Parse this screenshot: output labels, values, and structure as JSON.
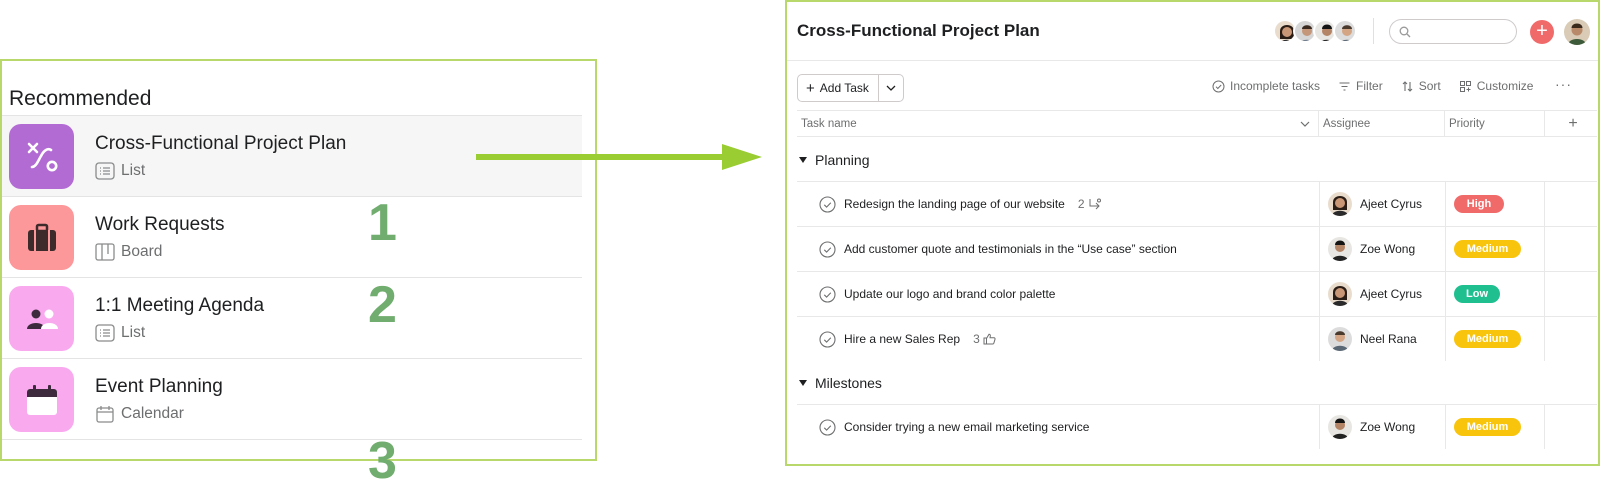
{
  "recommended": {
    "heading": "Recommended",
    "items": [
      {
        "title": "Cross-Functional Project Plan",
        "view": "List",
        "icon": "connect-path-icon",
        "tile_color": "#b36bd4",
        "view_icon": "list-view-icon",
        "step": "1"
      },
      {
        "title": "Work Requests",
        "view": "Board",
        "icon": "briefcase-icon",
        "tile_color": "#fc979a",
        "view_icon": "board-view-icon",
        "step": "2"
      },
      {
        "title": "1:1 Meeting Agenda",
        "view": "List",
        "icon": "people-icon",
        "tile_color": "#f9aaef",
        "view_icon": "list-view-icon",
        "step": ""
      },
      {
        "title": "Event Planning",
        "view": "Calendar",
        "icon": "calendar-icon",
        "tile_color": "#f9aaef",
        "view_icon": "calendar-view-icon",
        "step": "3"
      }
    ]
  },
  "project": {
    "title": "Cross-Functional Project Plan",
    "search_placeholder": "",
    "add_task_label": "Add Task",
    "toolbar": {
      "incomplete": "Incomplete tasks",
      "filter": "Filter",
      "sort": "Sort",
      "customize": "Customize",
      "more": "···"
    },
    "columns": {
      "name": "Task name",
      "assignee": "Assignee",
      "priority": "Priority",
      "add": "+"
    },
    "sections": [
      {
        "name": "Planning",
        "tasks": [
          {
            "name": "Redesign the landing page of our website",
            "meta": "2",
            "meta_icon": "subtask-icon",
            "assignee": "Ajeet Cyrus",
            "priority": "High"
          },
          {
            "name": "Add customer quote and testimonials in the “Use case” section",
            "meta": "",
            "meta_icon": "",
            "assignee": "Zoe Wong",
            "priority": "Medium"
          },
          {
            "name": "Update our logo and brand color palette",
            "meta": "",
            "meta_icon": "",
            "assignee": "Ajeet Cyrus",
            "priority": "Low"
          },
          {
            "name": "Hire a new Sales Rep",
            "meta": "3",
            "meta_icon": "like-icon",
            "assignee": "Neel Rana",
            "priority": "Medium"
          }
        ]
      },
      {
        "name": "Milestones",
        "tasks": [
          {
            "name": "Consider trying a new email marketing service",
            "meta": "",
            "meta_icon": "",
            "assignee": "Zoe Wong",
            "priority": "Medium"
          }
        ]
      }
    ],
    "colors": {
      "high": "#f06a6a",
      "medium": "#f8c40c",
      "low": "#1fbf8f",
      "accent_plus": "#f06a6a",
      "frame": "#b9d86b",
      "arrow": "#9acd32",
      "step_number": "#70ad6e"
    }
  }
}
